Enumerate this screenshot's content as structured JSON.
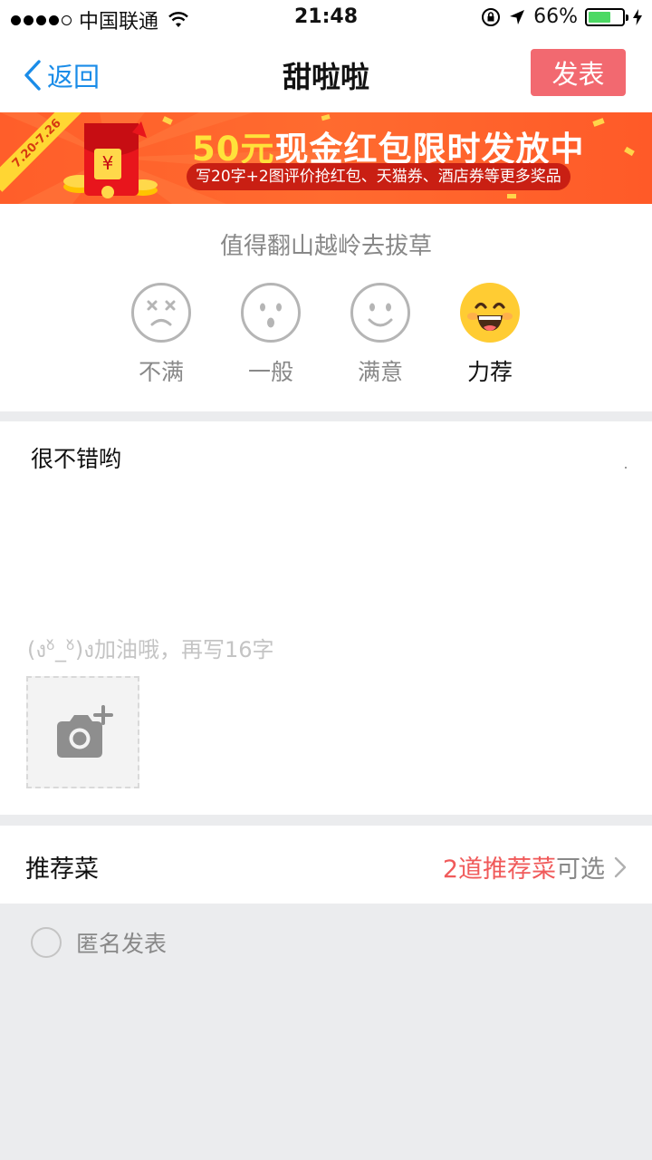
{
  "status_bar": {
    "carrier": "中国联通",
    "time": "21:48",
    "battery_percent": "66%",
    "battery_level": 0.66,
    "signal_bars_filled": 4,
    "signal_bars_total": 5
  },
  "nav": {
    "back_label": "返回",
    "title": "甜啦啦",
    "publish_label": "发表"
  },
  "banner": {
    "date_range": "7.20-7.26",
    "headline_highlight": "50元",
    "headline_rest": "现金红包限时发放中",
    "subline": "写20字+2图评价抢红包、天猫券、酒店券等更多奖品"
  },
  "rating": {
    "prompt": "值得翻山越岭去拔草",
    "options": [
      {
        "label": "不满",
        "icon": "dissatisfied-face-icon"
      },
      {
        "label": "一般",
        "icon": "neutral-face-icon"
      },
      {
        "label": "满意",
        "icon": "satisfied-face-icon"
      },
      {
        "label": "力荐",
        "icon": "highly-recommend-face-icon"
      }
    ],
    "selected": "力荐"
  },
  "review": {
    "text": "很不错哟",
    "hint": "(งᵒ̌_ᵒ̌)ง加油哦，再写16字"
  },
  "recommend": {
    "label": "推荐菜",
    "count_text": "2道推荐菜",
    "suffix": "可选"
  },
  "anonymous": {
    "label": "匿名发表",
    "checked": false
  },
  "colors": {
    "accent_blue": "#1a8ce8",
    "publish_red": "#f26970",
    "recommend_red": "#f05a5a",
    "emoji_yellow": "#ffcc33"
  }
}
